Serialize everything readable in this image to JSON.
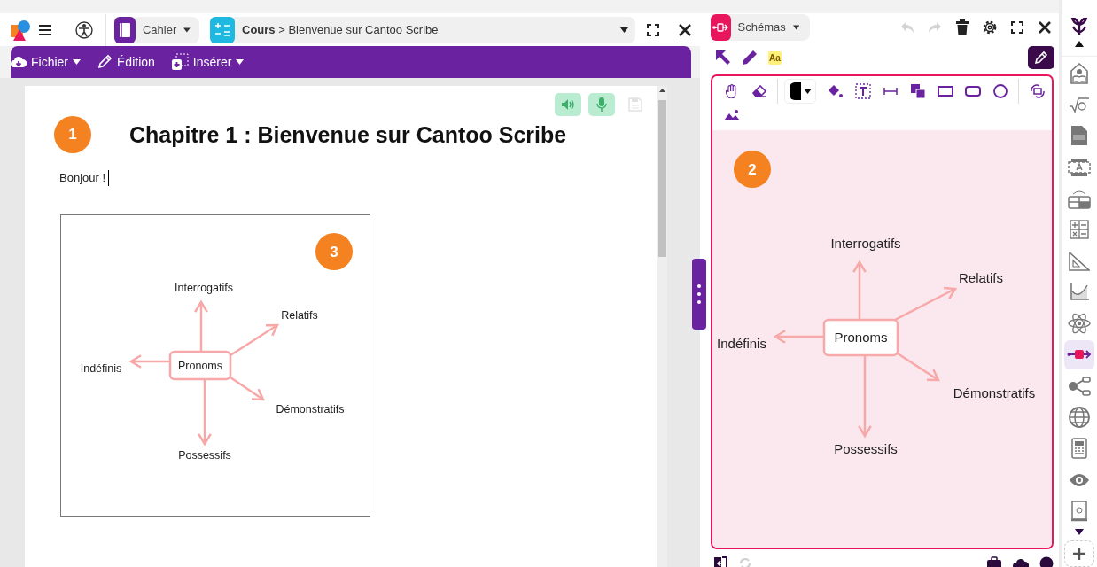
{
  "app_bar": {
    "notebook_tab": {
      "label": "Cahier"
    },
    "breadcrumb": "**Cours** > Bienvenue sur Cantoo Scribe"
  },
  "menu": [
    {
      "label": "Fichier",
      "kind": "cloud",
      "dropdown": true
    },
    {
      "label": "Édition",
      "kind": "pencil",
      "dropdown": false
    },
    {
      "label": "Insérer",
      "kind": "insert",
      "dropdown": true
    }
  ],
  "document": {
    "tools": [
      {
        "kind": "speak",
        "disabled": false
      },
      {
        "kind": "dictate",
        "disabled": false
      },
      {
        "kind": "save",
        "disabled": true
      }
    ],
    "badge": "1",
    "title": "Chapitre 1 : Bienvenue sur Cantoo Scribe",
    "text": "Bonjour !",
    "diagram": {
      "badge": "3",
      "center": "Pronoms",
      "branches": [
        "Interrogatifs",
        "Relatifs",
        "Démonstratifs",
        "Possessifs",
        "Indéfinis"
      ]
    }
  },
  "schema_panel": {
    "title": "Schémas",
    "header_tools": [
      {
        "kind": "undo",
        "disabled": true
      },
      {
        "kind": "redo",
        "disabled": true
      },
      {
        "kind": "trash",
        "disabled": false
      },
      {
        "kind": "settings",
        "disabled": false
      },
      {
        "kind": "fullscreen",
        "disabled": false
      },
      {
        "kind": "close",
        "disabled": false
      }
    ],
    "mode_label": "Aa",
    "diagram": {
      "badge": "2",
      "center": "Pronoms",
      "branches": [
        "Interrogatifs",
        "Relatifs",
        "Démonstratifs",
        "Possessifs",
        "Indéfinis"
      ]
    },
    "footer_tools": [
      {
        "kind": "exit",
        "disabled": false
      },
      {
        "kind": "refresh",
        "disabled": true
      },
      {
        "kind": "briefcase",
        "disabled": false
      },
      {
        "kind": "upload",
        "disabled": false
      },
      {
        "kind": "help",
        "disabled": false
      }
    ]
  },
  "sidebar": {
    "tools": [
      {
        "kind": "library",
        "selected": false
      },
      {
        "kind": "sqrt",
        "selected": false
      },
      {
        "kind": "pdf",
        "selected": false
      },
      {
        "kind": "scan",
        "selected": false
      },
      {
        "kind": "table",
        "selected": false
      },
      {
        "kind": "operations",
        "selected": false
      },
      {
        "kind": "ruler",
        "selected": false
      },
      {
        "kind": "graph",
        "selected": false
      },
      {
        "kind": "atom",
        "selected": false
      },
      {
        "kind": "diagram",
        "selected": true
      },
      {
        "kind": "tree",
        "selected": false
      },
      {
        "kind": "globe",
        "selected": false
      },
      {
        "kind": "calculator",
        "selected": false
      },
      {
        "kind": "eye",
        "selected": false
      },
      {
        "kind": "ebook",
        "selected": false
      }
    ]
  }
}
